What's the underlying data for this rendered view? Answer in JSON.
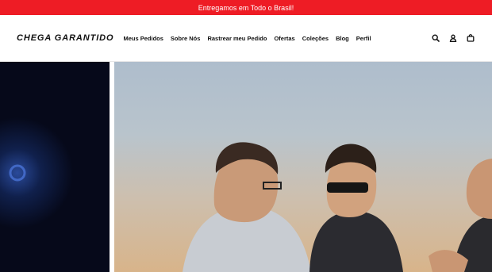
{
  "announcement": {
    "text": "Entregamos em Todo o Brasil!"
  },
  "header": {
    "logo": "CHEGA GARANTIDO",
    "nav": [
      {
        "label": "Meus Pedidos"
      },
      {
        "label": "Sobre Nós"
      },
      {
        "label": "Rastrear meu Pedido"
      },
      {
        "label": "Ofertas"
      },
      {
        "label": "Coleções"
      },
      {
        "label": "Blog"
      },
      {
        "label": "Perfil"
      }
    ],
    "icons": [
      "search-icon",
      "account-icon",
      "cart-icon"
    ]
  },
  "colors": {
    "announcement_bg": "#ee1c25",
    "text": "#111111"
  }
}
